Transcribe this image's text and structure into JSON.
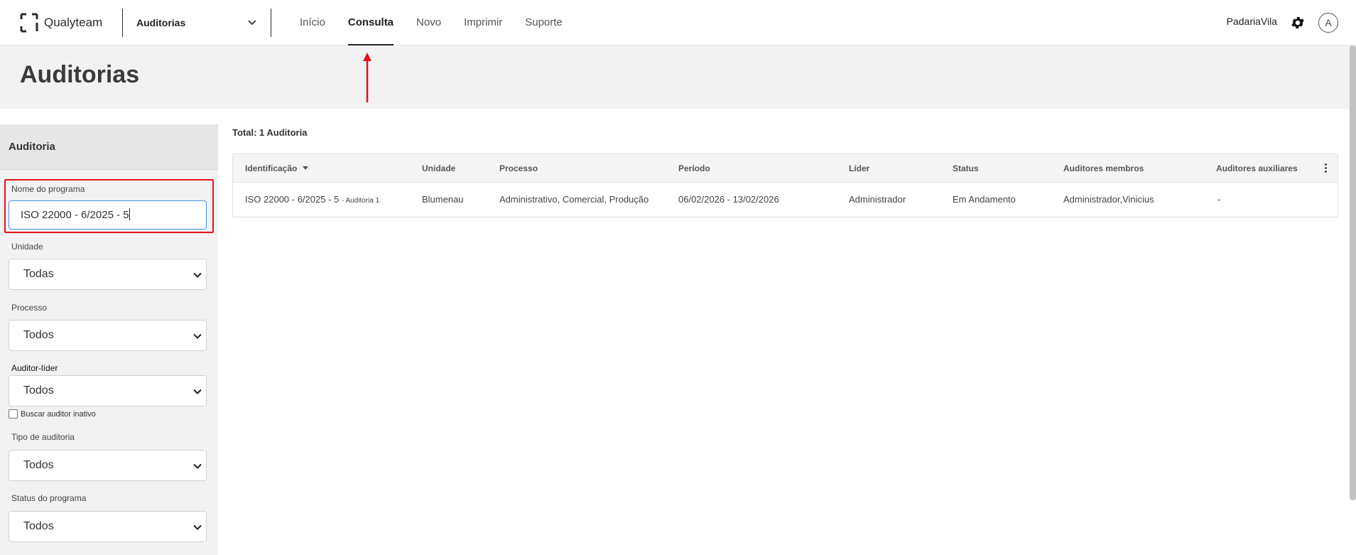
{
  "app": {
    "logo_text": "Qualyteam",
    "module": "Auditorias",
    "company": "PadariaVila",
    "avatar_letter": "A"
  },
  "nav": {
    "items": [
      "Início",
      "Consulta",
      "Novo",
      "Imprimir",
      "Suporte"
    ],
    "active": "Consulta"
  },
  "page": {
    "title": "Auditorias"
  },
  "filters": {
    "heading": "Auditoria",
    "program_name_label": "Nome do programa",
    "program_name_value": "ISO 22000 - 6/2025 - 5",
    "unit_label": "Unidade",
    "unit_value": "Todas",
    "process_label": "Processo",
    "process_value": "Todos",
    "lead_auditor_label": "Auditor-líder",
    "lead_auditor_value": "Todos",
    "inactive_auditor_label": "Buscar auditor inativo",
    "audit_type_label": "Tipo de auditoria",
    "audit_type_value": "Todos",
    "program_status_label": "Status do programa",
    "program_status_value": "Todos"
  },
  "results": {
    "total": "Total: 1 Auditoria",
    "columns": [
      "Identificação",
      "Unidade",
      "Processo",
      "Período",
      "Líder",
      "Status",
      "Auditores membros",
      "Auditores auxiliares"
    ],
    "rows": [
      {
        "id": "ISO 22000 - 6/2025 - 5",
        "id_suffix": "- Auditoria 1",
        "unit": "Blumenau",
        "process": "Administrativo, Comercial, Produção",
        "period": "06/02/2026 - 13/02/2026",
        "leader": "Administrador",
        "status": "Em Andamento",
        "members": "Administrador,Vinicius",
        "auxiliaries": "-"
      }
    ]
  },
  "colors": {
    "annotation_red": "#e0141b",
    "input_focus": "#4a90e2",
    "header_bg": "#f2f2f2"
  }
}
